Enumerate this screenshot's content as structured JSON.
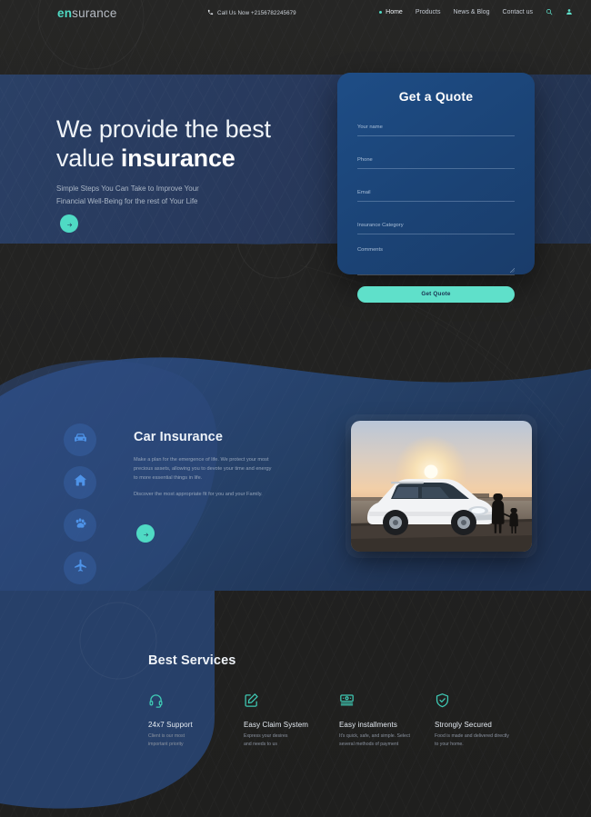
{
  "header": {
    "logo_prefix": "en",
    "logo_suffix": "surance",
    "call_label": "Call Us Now +2156782245679",
    "nav": [
      {
        "label": "Home",
        "active": true
      },
      {
        "label": "Products",
        "active": false
      },
      {
        "label": "News & Blog",
        "active": false
      },
      {
        "label": "Contact us",
        "active": false
      }
    ],
    "search_icon": "search-icon",
    "account_icon": "user-icon"
  },
  "hero": {
    "heading_line1": "We provide the best",
    "heading_line2_light": "value ",
    "heading_line2_bold": "insurance",
    "sub_line1": "Simple Steps You Can Take to Improve Your",
    "sub_line2": "Financial Well-Being for the rest of Your Life",
    "cta_icon": "arrow-right-icon"
  },
  "quote_form": {
    "title": "Get a Quote",
    "fields": [
      {
        "name": "your-name",
        "placeholder": "Your name",
        "value": "",
        "type": "text"
      },
      {
        "name": "phone",
        "placeholder": "Phone",
        "value": "",
        "type": "text"
      },
      {
        "name": "email",
        "placeholder": "Email",
        "value": "",
        "type": "text"
      },
      {
        "name": "insurance-category",
        "placeholder": "Insurance Category",
        "value": "",
        "type": "text"
      },
      {
        "name": "comments",
        "placeholder": "Comments",
        "value": "",
        "type": "textarea"
      }
    ],
    "submit_label": "Get Quote"
  },
  "car_section": {
    "category_icons": [
      "car-icon",
      "home-icon",
      "paw-icon",
      "airplane-icon"
    ],
    "title": "Car Insurance",
    "paragraph1": "Make a plan for the emergence of life. We protect your most precious assets, allowing you to devote your time and energy to more essential things in life.",
    "paragraph2": "Discover the most appropriate fit for you and your Family.",
    "cta_icon": "arrow-right-icon",
    "photo_alt": "white-suv-at-sunset-photo"
  },
  "services": {
    "title": "Best Services",
    "items": [
      {
        "icon": "headset-icon",
        "title": "24x7 Support",
        "desc_line1": "Client is our most",
        "desc_line2": "important priority"
      },
      {
        "icon": "edit-square-icon",
        "title": "Easy Claim System",
        "desc_line1": "Express your desires",
        "desc_line2": "and needs to us"
      },
      {
        "icon": "money-icon",
        "title": "Easy installments",
        "desc_line1": "It's quick, safe, and simple. Select",
        "desc_line2": "several methods of payment"
      },
      {
        "icon": "shield-check-icon",
        "title": "Strongly Secured",
        "desc_line1": "Food is made and delivered directly",
        "desc_line2": "to your home."
      }
    ]
  },
  "colors": {
    "accent_teal": "#4fdac4",
    "blue_panel": "#28395c",
    "card_blue": "#1b4477",
    "icon_blue": "#4e93e8",
    "dark_bg": "#232322"
  }
}
